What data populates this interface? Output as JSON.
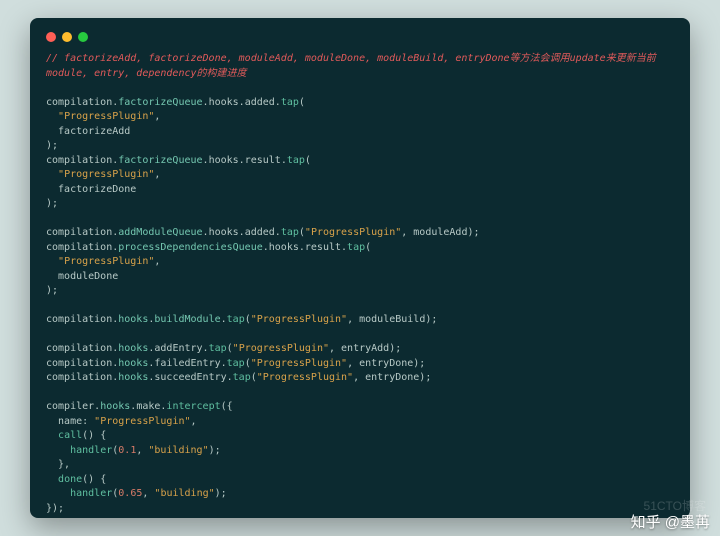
{
  "watermark": "知乎 @墨苒",
  "watermark_faint": "51CTO博客",
  "code": {
    "comment1": "// factorizeAdd, factorizeDone, moduleAdd, moduleDone, moduleBuild, entryDone等方法会调用update来更新当前",
    "comment2": "module, entry, dependency的构建进度",
    "l1a": "compilation.",
    "l1b": "factorizeQueue",
    "l1c": ".hooks.added.",
    "l1d": "tap",
    "l1e": "(",
    "l2a": "  ",
    "l2b": "\"ProgressPlugin\"",
    "l2c": ",",
    "l3a": "  factorizeAdd",
    "l4": ");",
    "l5a": "compilation.",
    "l5b": "factorizeQueue",
    "l5c": ".hooks.result.",
    "l5d": "tap",
    "l5e": "(",
    "l6a": "  ",
    "l6b": "\"ProgressPlugin\"",
    "l6c": ",",
    "l7a": "  factorizeDone",
    "l8": ");",
    "l9a": "compilation.",
    "l9b": "addModuleQueue",
    "l9c": ".hooks.added.",
    "l9d": "tap",
    "l9e": "(",
    "l9f": "\"ProgressPlugin\"",
    "l9g": ", moduleAdd);",
    "l10a": "compilation.",
    "l10b": "processDependenciesQueue",
    "l10c": ".hooks.result.",
    "l10d": "tap",
    "l10e": "(",
    "l11a": "  ",
    "l11b": "\"ProgressPlugin\"",
    "l11c": ",",
    "l12a": "  moduleDone",
    "l13": ");",
    "l14a": "compilation.",
    "l14b": "hooks",
    "l14c": ".",
    "l14d": "buildModule",
    "l14e": ".",
    "l14f": "tap",
    "l14g": "(",
    "l14h": "\"ProgressPlugin\"",
    "l14i": ", moduleBuild);",
    "l15a": "compilation.",
    "l15b": "hooks",
    "l15c": ".addEntry.",
    "l15d": "tap",
    "l15e": "(",
    "l15f": "\"ProgressPlugin\"",
    "l15g": ", entryAdd);",
    "l16a": "compilation.",
    "l16b": "hooks",
    "l16c": ".failedEntry.",
    "l16d": "tap",
    "l16e": "(",
    "l16f": "\"ProgressPlugin\"",
    "l16g": ", entryDone);",
    "l17a": "compilation.",
    "l17b": "hooks",
    "l17c": ".succeedEntry.",
    "l17d": "tap",
    "l17e": "(",
    "l17f": "\"ProgressPlugin\"",
    "l17g": ", entryDone);",
    "l18a": "compiler.",
    "l18b": "hooks",
    "l18c": ".make.",
    "l18d": "intercept",
    "l18e": "({",
    "l19a": "  name: ",
    "l19b": "\"ProgressPlugin\"",
    "l19c": ",",
    "l20a": "  ",
    "l20b": "call",
    "l20c": "() {",
    "l21a": "    ",
    "l21b": "handler",
    "l21c": "(",
    "l21d": "0.1",
    "l21e": ", ",
    "l21f": "\"building\"",
    "l21g": ");",
    "l22": "  },",
    "l23a": "  ",
    "l23b": "done",
    "l23c": "() {",
    "l24a": "    ",
    "l24b": "handler",
    "l24c": "(",
    "l24d": "0.65",
    "l24e": ", ",
    "l24f": "\"building\"",
    "l24g": ");",
    "l25": "});"
  }
}
